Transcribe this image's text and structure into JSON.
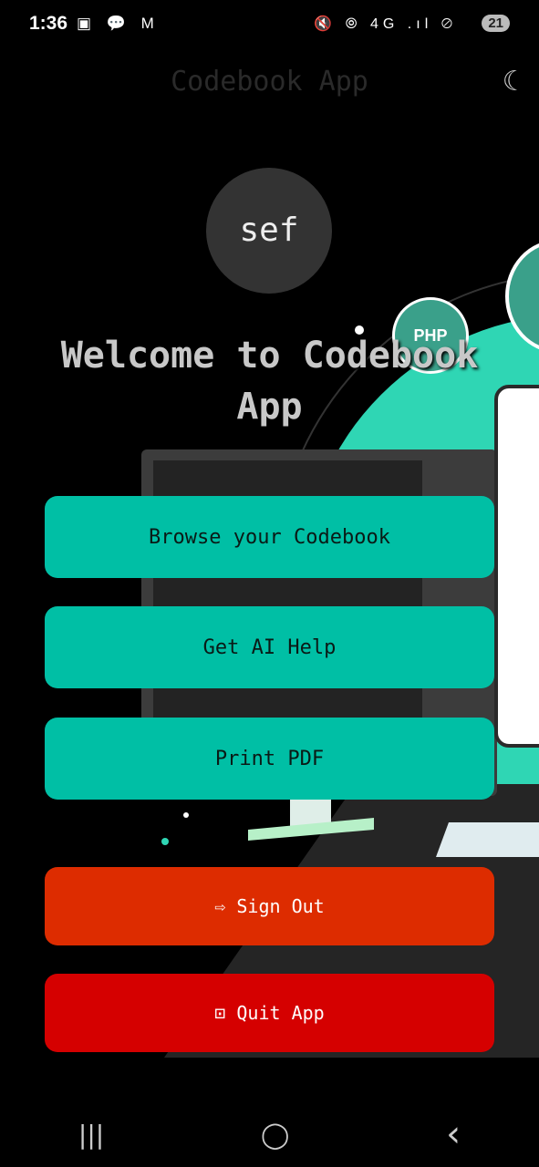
{
  "status_bar": {
    "time": "1:36",
    "left_icons": "▣ 💬 M",
    "right_icons": "🔇 ⦾ 4G .ıl ⊘",
    "battery": "21"
  },
  "header": {
    "title": "Codebook App",
    "theme_icon": "moon-icon",
    "theme_glyph": "☾"
  },
  "avatar": {
    "initials": "sef"
  },
  "welcome": "Welcome to Codebook App",
  "illustration": {
    "badge_text": "PHP",
    "accent": "#2fd6b4"
  },
  "buttons": {
    "browse": "Browse your Codebook",
    "ai": "Get AI Help",
    "pdf": "Print PDF",
    "signout": "Sign Out",
    "quit": "Quit App",
    "signout_icon": "⇨",
    "quit_icon": "⊡"
  },
  "colors": {
    "teal": "#00bfa5",
    "signout": "#dd2c00",
    "quit": "#d50000"
  },
  "nav": {
    "recents": "|||",
    "home": "◯",
    "back": "‹"
  }
}
